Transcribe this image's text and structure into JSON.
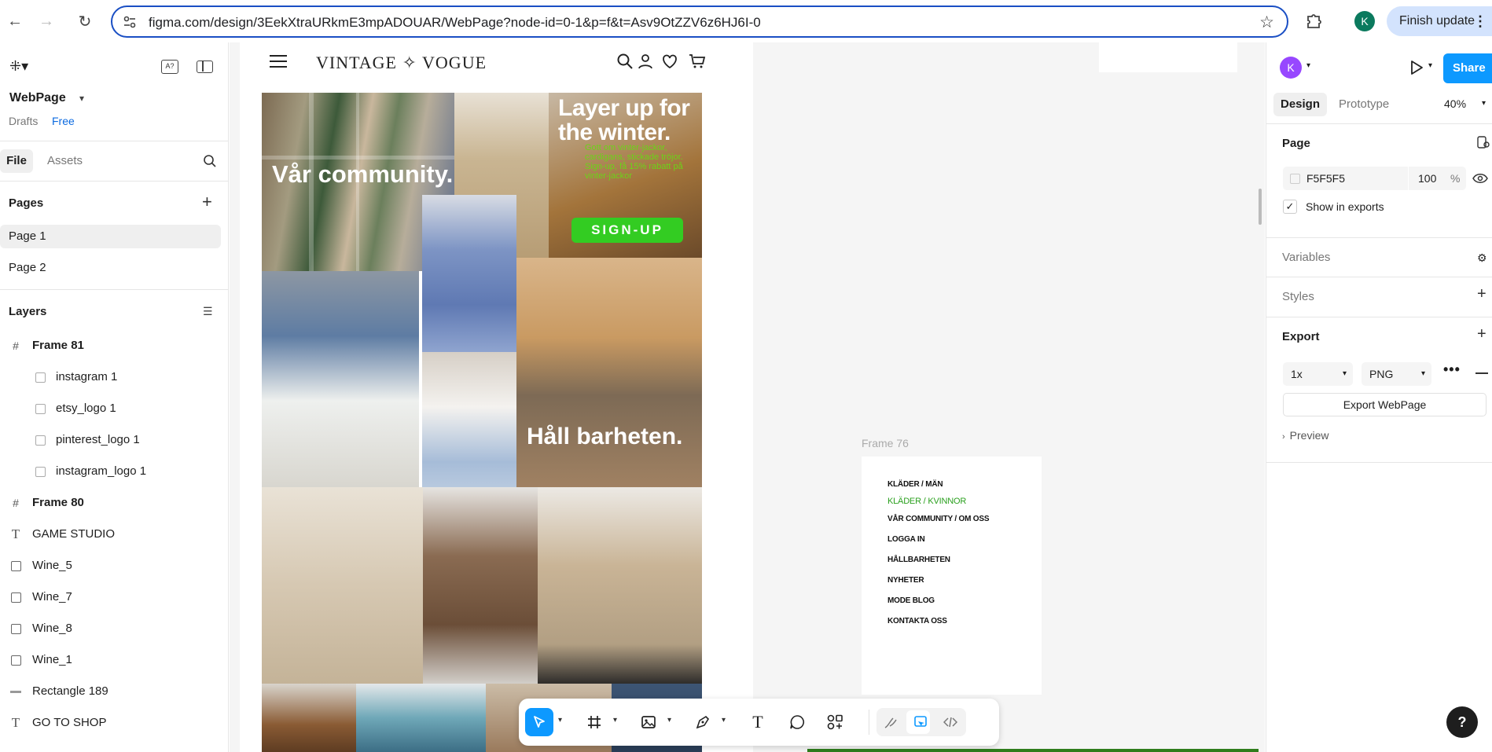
{
  "browser": {
    "url": "figma.com/design/3EekXtraURkmE3mpADOUAR/WebPage?node-id=0-1&p=f&t=Asv9OtZZV6z6HJ6I-0",
    "profile_initial": "K",
    "finish_update_label": "Finish update"
  },
  "left_panel": {
    "file_name": "WebPage",
    "location": "Drafts",
    "plan": "Free",
    "tabs": [
      "File",
      "Assets"
    ],
    "pages_title": "Pages",
    "pages": [
      "Page 1",
      "Page 2"
    ],
    "layers_title": "Layers",
    "layers": [
      {
        "name": "Frame 81",
        "type": "frame"
      },
      {
        "name": "instagram 1",
        "type": "image"
      },
      {
        "name": "etsy_logo 1",
        "type": "image"
      },
      {
        "name": "pinterest_logo 1",
        "type": "image"
      },
      {
        "name": "instagram_logo 1",
        "type": "image"
      },
      {
        "name": "Frame 80",
        "type": "frame"
      },
      {
        "name": "GAME STUDIO",
        "type": "text"
      },
      {
        "name": "Wine_5",
        "type": "image"
      },
      {
        "name": "Wine_7",
        "type": "image"
      },
      {
        "name": "Wine_8",
        "type": "image"
      },
      {
        "name": "Wine_1",
        "type": "image"
      },
      {
        "name": "Rectangle 189",
        "type": "rectangle"
      },
      {
        "name": "GO TO SHOP",
        "type": "text"
      }
    ]
  },
  "canvas": {
    "brand": "VINTAGE ✧ VOGUE",
    "community_text": "Vår community.",
    "layer_up_title": "Layer up for the winter.",
    "layer_up_sub": "Gott om vinter-jackor, cardigans, stickade tröjor. Sign-up, få 15% rabatt på vinter-jackor",
    "signup_label": "SIGN-UP",
    "sustain_text": "Håll barheten.",
    "frame76_label": "Frame 76",
    "frame76_menu": [
      "KLÄDER / MÄN",
      "KLÄDER / KVINNOR",
      "VÅR COMMUNITY / OM OSS",
      "LOGGA IN",
      "HÅLLBARHETEN",
      "NYHETER",
      "MODE BLOG",
      "KONTAKTA OSS"
    ],
    "accent_green": "#33cc22"
  },
  "toolbar": {
    "tools": [
      "move",
      "frame",
      "image",
      "pen",
      "text",
      "comment",
      "actions",
      "draw",
      "design",
      "dev-mode"
    ]
  },
  "right_panel": {
    "avatar_initial": "K",
    "share_label": "Share",
    "tabs": [
      "Design",
      "Prototype"
    ],
    "zoom": "40%",
    "page_section": "Page",
    "bg_color": "F5F5F5",
    "bg_opacity": "100",
    "percent": "%",
    "show_in_exports": "Show in exports",
    "variables": "Variables",
    "styles": "Styles",
    "export": "Export",
    "export_scale": "1x",
    "export_format": "PNG",
    "export_button": "Export WebPage",
    "preview": "Preview",
    "help": "?"
  }
}
